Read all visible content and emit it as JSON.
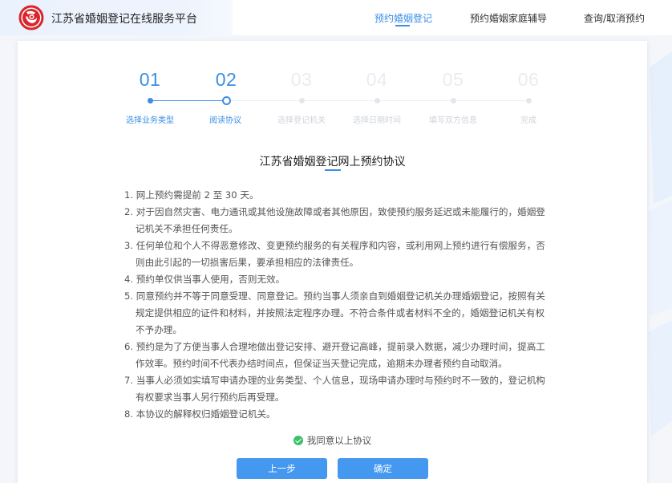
{
  "header": {
    "site_title": "江苏省婚姻登记在线服务平台",
    "nav": [
      {
        "label": "预约婚姻登记",
        "active": true
      },
      {
        "label": "预约婚姻家庭辅导",
        "active": false
      },
      {
        "label": "查询/取消预约",
        "active": false
      }
    ]
  },
  "steps": [
    {
      "num": "01",
      "label": "选择业务类型",
      "state": "done"
    },
    {
      "num": "02",
      "label": "阅读协议",
      "state": "current"
    },
    {
      "num": "03",
      "label": "选择登记机关",
      "state": "pending"
    },
    {
      "num": "04",
      "label": "选择日期时间",
      "state": "pending"
    },
    {
      "num": "05",
      "label": "填写双方信息",
      "state": "pending"
    },
    {
      "num": "06",
      "label": "完成",
      "state": "pending"
    }
  ],
  "agreement": {
    "title": "江苏省婚姻登记网上预约协议",
    "terms": [
      "1. 网上预约需提前 2 至 30 天。",
      "2. 对于因自然灾害、电力通讯或其他设施故障或者其他原因，致使预约服务延迟或未能履行的，婚姻登记机关不承担任何责任。",
      "3. 任何单位和个人不得恶意修改、变更预约服务的有关程序和内容，或利用网上预约进行有偿服务，否则由此引起的一切损害后果，要承担相应的法律责任。",
      "4. 预约单仅供当事人使用，否则无效。",
      "5. 同意预约并不等于同意受理、同意登记。预约当事人须亲自到婚姻登记机关办理婚姻登记，按照有关规定提供相应的证件和材料，并按照法定程序办理。不符合条件或者材料不全的，婚姻登记机关有权不予办理。",
      "6. 预约是为了方便当事人合理地做出登记安排、避开登记高峰，提前录入数据，减少办理时间，提高工作效率。预约时间不代表办结时间点，但保证当天登记完成，逾期未办理者预约自动取消。",
      "7. 当事人必须如实填写申请办理的业务类型、个人信息，现场申请办理时与预约时不一致的，登记机构有权要求当事人另行预约后再受理。",
      "8. 本协议的解释权归婚姻登记机关。"
    ],
    "agree_label": "我同意以上协议"
  },
  "buttons": {
    "prev_label": "上一步",
    "confirm_label": "确定"
  },
  "colors": {
    "accent": "#3a8ee6",
    "button": "#4498f0",
    "check": "#3ec06a",
    "logo_red": "#d9262c"
  }
}
